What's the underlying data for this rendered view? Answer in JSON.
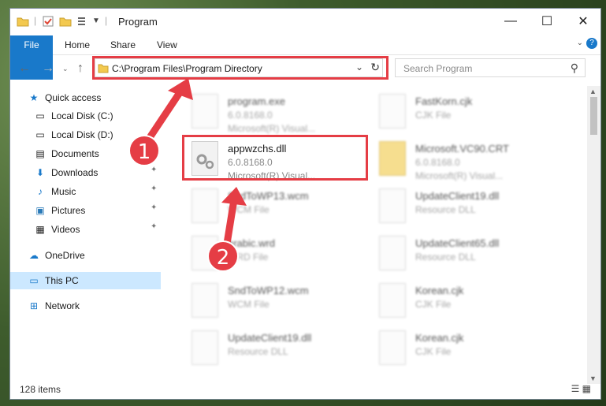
{
  "window": {
    "title": "Program"
  },
  "controls": {
    "minimize": "—",
    "maximize": "☐",
    "close": "✕",
    "help": "?"
  },
  "ribbon": {
    "tabs": [
      "File",
      "Home",
      "Share",
      "View"
    ]
  },
  "address": {
    "path": "C:\\Program Files\\Program Directory"
  },
  "search": {
    "placeholder": "Search Program"
  },
  "sidebar": {
    "items": [
      {
        "label": "Quick access"
      },
      {
        "label": "Local Disk (C:)"
      },
      {
        "label": "Local Disk (D:)"
      },
      {
        "label": "Documents"
      },
      {
        "label": "Downloads"
      },
      {
        "label": "Music"
      },
      {
        "label": "Pictures"
      },
      {
        "label": "Videos"
      },
      {
        "label": "OneDrive"
      },
      {
        "label": "This PC"
      },
      {
        "label": "Network"
      }
    ]
  },
  "files": {
    "highlight": {
      "name": "appwzchs.dll",
      "version": "6.0.8168.0",
      "desc": "Microsoft(R) Visual..."
    },
    "program": {
      "name": "program.exe",
      "version": "6.0.8168.0",
      "desc": "Microsoft(R) Visual..."
    },
    "left": [
      {
        "name": "SndToWP13.wcm",
        "type": "WCM File"
      },
      {
        "name": "arabic.wrd",
        "type": "WRD File"
      },
      {
        "name": "SndToWP12.wcm",
        "type": "WCM File"
      },
      {
        "name": "UpdateClient19.dll",
        "type": "Resource DLL"
      }
    ],
    "right": [
      {
        "name": "FastKorn.cjk",
        "type": "CJK File"
      },
      {
        "name": "Microsoft.VC90.CRT",
        "type": "6.0.8168.0",
        "sub": "Microsoft(R) Visual..."
      },
      {
        "name": "UpdateClient19.dll",
        "type": "Resource DLL"
      },
      {
        "name": "UpdateClient65.dll",
        "type": "Resource DLL"
      },
      {
        "name": "Korean.cjk",
        "type": "CJK File"
      },
      {
        "name": "Korean.cjk",
        "type": "CJK File"
      }
    ]
  },
  "status": {
    "items": "128 items"
  },
  "annotations": {
    "one": "1",
    "two": "2"
  },
  "colors": {
    "accent": "#1979ca",
    "highlight": "#e53d45",
    "selection": "#cce8ff"
  }
}
